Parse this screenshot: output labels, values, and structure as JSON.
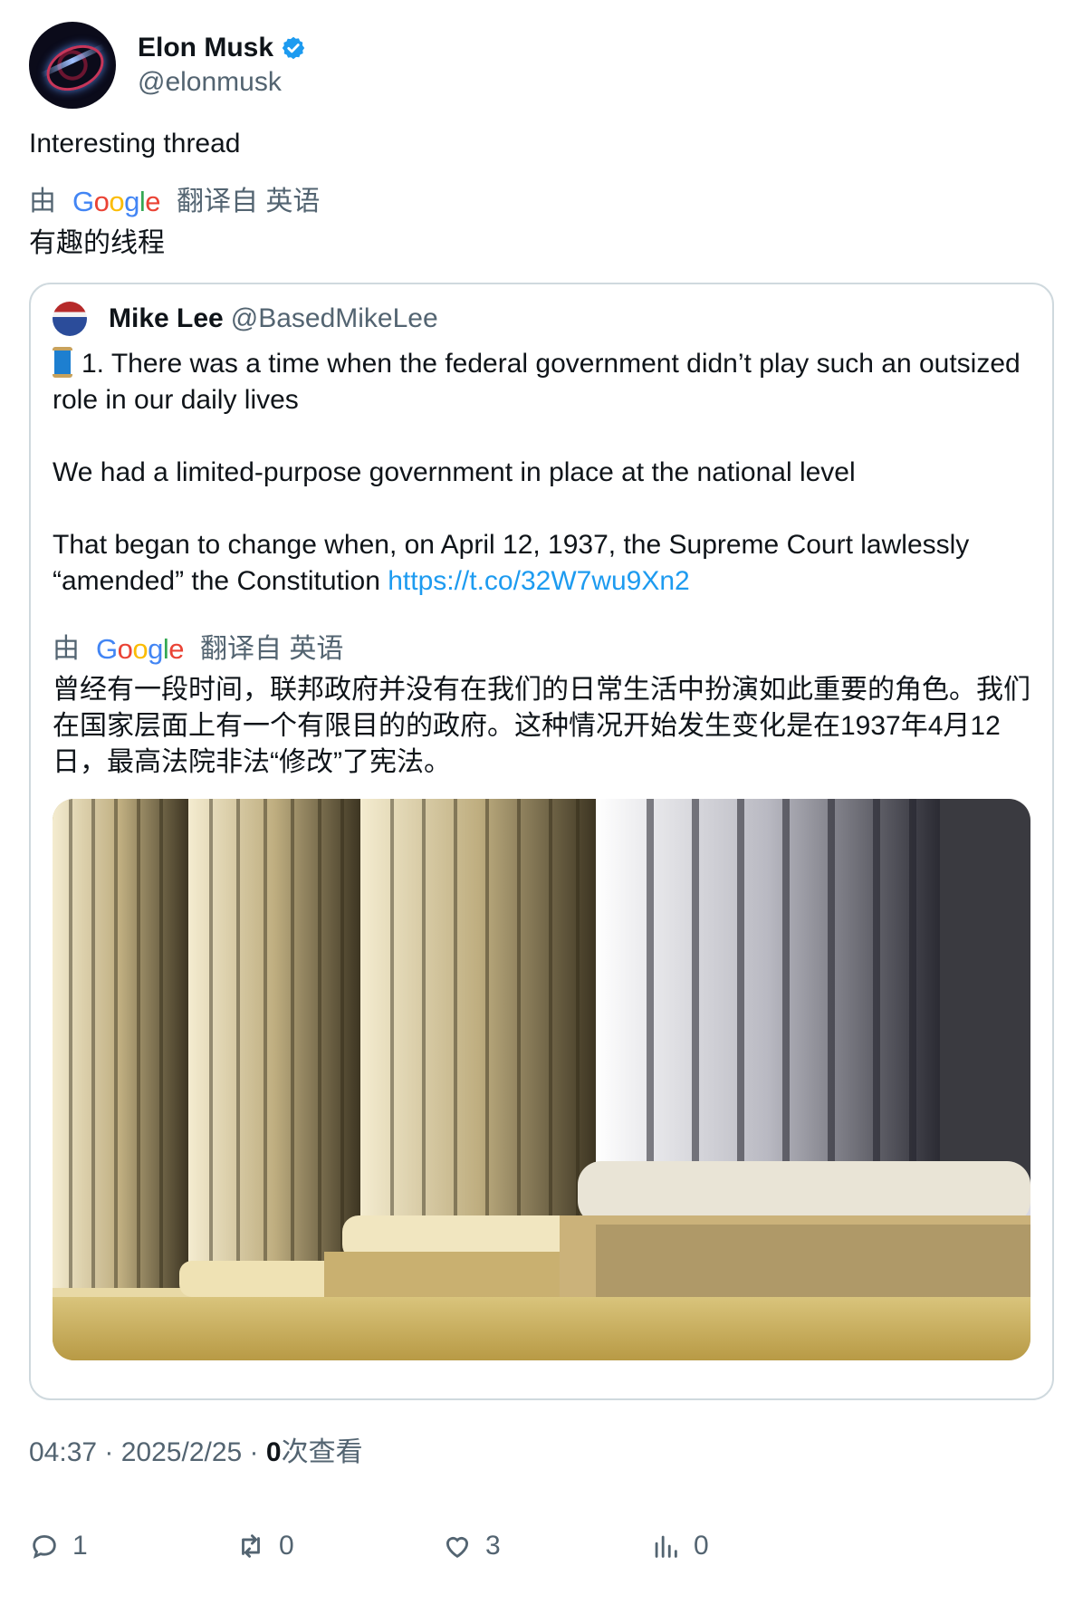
{
  "author": {
    "name": "Elon Musk",
    "handle": "@elonmusk",
    "verified_icon": "verified-badge-icon"
  },
  "tweet": {
    "text": "Interesting thread",
    "translate": {
      "by": "由",
      "logo": "Google",
      "from": "翻译自 英语"
    },
    "translated_text": "有趣的线程"
  },
  "quote": {
    "name": "Mike Lee",
    "handle": "@BasedMikeLee",
    "body_part1": "1. There was a time when the federal government didn’t play such an outsized role in our daily lives\n\nWe had a limited-purpose government in place at the national level\n\nThat began to change when, on April 12, 1937, the Supreme Court lawlessly “amended” the Constitution ",
    "link": "https://t.co/32W7wu9Xn2",
    "translate": {
      "by": "由",
      "logo": "Google",
      "from": "翻译自 英语"
    },
    "translated_text": "曾经有一段时间，联邦政府并没有在我们的日常生活中扮演如此重要的角色。我们在国家层面上有一个有限目的的政府。这种情况开始发生变化是在1937年4月12日，最高法院非法“修改”了宪法。"
  },
  "meta": {
    "time": "04:37",
    "sep1": " · ",
    "date": "2025/2/25",
    "sep2": " · ",
    "views_count": "0",
    "views_label": "次查看"
  },
  "actions": {
    "reply": "1",
    "retweet": "0",
    "like": "3",
    "views": "0"
  },
  "colors": {
    "link": "#1d9bf0",
    "muted": "#536471",
    "border": "#cfd9de"
  }
}
